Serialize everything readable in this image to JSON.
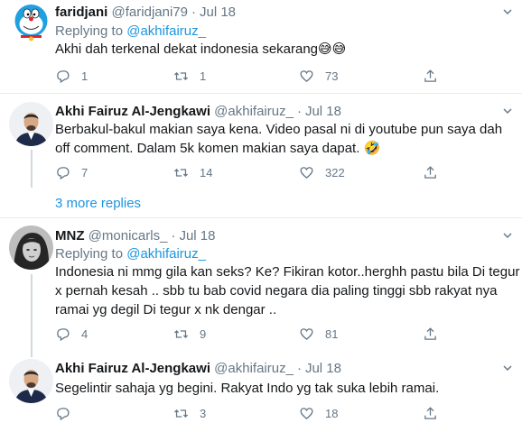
{
  "tweets": [
    {
      "name": "faridjani",
      "handle": "@faridjani79",
      "date": "Jul 18",
      "replying_label": "Replying to",
      "replying_to": "@akhifairuz_",
      "text": "Akhi dah terkenal dekat indonesia sekarang",
      "emoji": "😅😅",
      "replies": "1",
      "retweets": "1",
      "likes": "73"
    },
    {
      "name": "Akhi Fairuz Al-Jengkawi",
      "handle": "@akhifairuz_",
      "date": "Jul 18",
      "text_line1": "Berbakul-bakul makian saya kena. Video pasal ni di youtube pun saya dah",
      "text_line2": "off comment. Dalam 5k komen makian saya dapat.",
      "emoji": "🤣",
      "replies": "7",
      "retweets": "14",
      "likes": "322"
    },
    {
      "name": "MNZ",
      "handle": "@monicarls_",
      "date": "Jul 18",
      "replying_label": "Replying to",
      "replying_to": "@akhifairuz_",
      "text_line1": "Indonesia ni mmg gila kan seks? Ke? Fikiran kotor..herghh pastu bila Di tegur",
      "text_line2": "x pernah kesah .. sbb tu bab covid negara dia paling tinggi sbb rakyat nya",
      "text_line3": "ramai yg degil Di tegur x nk dengar ..",
      "replies": "4",
      "retweets": "9",
      "likes": "81"
    },
    {
      "name": "Akhi Fairuz Al-Jengkawi",
      "handle": "@akhifairuz_",
      "date": "Jul 18",
      "text": "Segelintir sahaja yg begini. Rakyat Indo yg tak suka lebih ramai.",
      "replies": "",
      "retweets": "3",
      "likes": "18"
    }
  ],
  "more_replies": "3 more replies",
  "colors": {
    "accent": "#1b95e0",
    "muted": "#657786",
    "border": "#e6ecf0"
  }
}
